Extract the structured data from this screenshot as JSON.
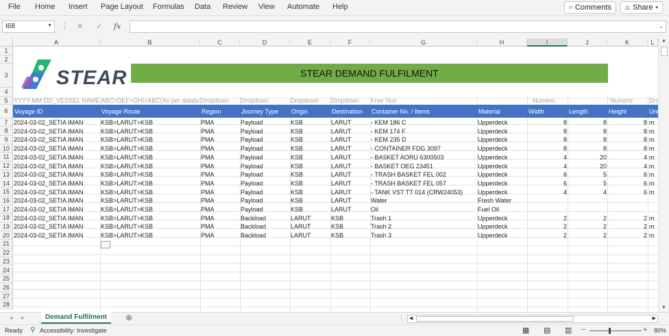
{
  "menu": [
    "File",
    "Home",
    "Insert",
    "Page Layout",
    "Formulas",
    "Data",
    "Review",
    "View",
    "Automate",
    "Help"
  ],
  "buttons": {
    "comments": "Comments",
    "share": "Share"
  },
  "namebox": "I68",
  "fx": "fx",
  "columns": [
    "A",
    "B",
    "C",
    "D",
    "E",
    "F",
    "G",
    "H",
    "I",
    "J",
    "K",
    "L"
  ],
  "selected_column": "I",
  "rows": [
    "1",
    "2",
    "3",
    "4",
    "5",
    "6",
    "7",
    "8",
    "9",
    "10",
    "11",
    "12",
    "13",
    "14",
    "15",
    "16",
    "17",
    "18",
    "19",
    "20",
    "21",
    "22",
    "23",
    "24",
    "25",
    "26",
    "27",
    "28"
  ],
  "banner": "STEAR DEMAND FULFILMENT",
  "logo": {
    "text": "STEAR",
    "colors": [
      "#3a7bd5",
      "#22b573",
      "#9b59b6"
    ]
  },
  "hints": {
    "a": "YYYY-MM-DD_VESSEL NAME",
    "b": "ABC>DEF>GHI>ABC(As per database)",
    "c": "Dropdown",
    "d": "Dropdown",
    "e": "Dropdown",
    "f": "Dropdown",
    "g": "Free Text",
    "i": "Numeric",
    "k": "Numeric",
    "l": "Dro"
  },
  "headers": {
    "a": "Voyage ID",
    "b": "Voyage Route",
    "c": "Region",
    "d": "Journey Type",
    "e": "Origin",
    "f": "Destination",
    "g": "Container No. / Items",
    "h": "Material",
    "i": "Width",
    "j": "Length",
    "k": "Height",
    "l": "Uni"
  },
  "table": [
    [
      "2024-03-02_SETIA IMAN",
      "KSB>LARUT>KSB",
      "PMA",
      "Payload",
      "KSB",
      "LARUT",
      "- KEM 186 C",
      "Upperdeck",
      "8",
      "8",
      "8",
      "m"
    ],
    [
      "2024-03-02_SETIA IMAN",
      "KSB>LARUT>KSB",
      "PMA",
      "Payload",
      "KSB",
      "LARUT",
      "- KEM 174 F",
      "Upperdeck",
      "8",
      "8",
      "8",
      "m"
    ],
    [
      "2024-03-02_SETIA IMAN",
      "KSB>LARUT>KSB",
      "PMA",
      "Payload",
      "KSB",
      "LARUT",
      "- KEM 235 D",
      "Upperdeck",
      "8",
      "8",
      "8",
      "m"
    ],
    [
      "2024-03-02_SETIA IMAN",
      "KSB>LARUT>KSB",
      "PMA",
      "Payload",
      "KSB",
      "LARUT",
      "- CONTAINER FDG 3097",
      "Upperdeck",
      "8",
      "8",
      "8",
      "m"
    ],
    [
      "2024-03-02_SETIA IMAN",
      "KSB>LARUT>KSB",
      "PMA",
      "Payload",
      "KSB",
      "LARUT",
      "- BASKET AORU 6300503",
      "Upperdeck",
      "4",
      "20",
      "4",
      "m"
    ],
    [
      "2024-03-02_SETIA IMAN",
      "KSB>LARUT>KSB",
      "PMA",
      "Payload",
      "KSB",
      "LARUT",
      "- BASKET OEG 23451",
      "Upperdeck",
      "4",
      "20",
      "4",
      "m"
    ],
    [
      "2024-03-02_SETIA IMAN",
      "KSB>LARUT>KSB",
      "PMA",
      "Payload",
      "KSB",
      "LARUT",
      "- TRASH  BASKET FEL 002",
      "Upperdeck",
      "6",
      "5",
      "6",
      "m"
    ],
    [
      "2024-03-02_SETIA IMAN",
      "KSB>LARUT>KSB",
      "PMA",
      "Payload",
      "KSB",
      "LARUT",
      "- TRASH  BASKET FEL 057",
      "Upperdeck",
      "6",
      "5",
      "6",
      "m"
    ],
    [
      "2024-03-02_SETIA IMAN",
      "KSB>LARUT>KSB",
      "PMA",
      "Payload",
      "KSB",
      "LARUT",
      "- TANK VST TT 014 (CRW24053)",
      "Upperdeck",
      "4",
      "4",
      "6",
      "m"
    ],
    [
      "2024-03-02_SETIA IMAN",
      "KSB>LARUT>KSB",
      "PMA",
      "Payload",
      "KSB",
      "LARUT",
      "Water",
      "Fresh Water",
      "",
      "",
      "",
      ""
    ],
    [
      "2024-03-02_SETIA IMAN",
      "KSB>LARUT>KSB",
      "PMA",
      "Payload",
      "KSB",
      "LARUT",
      "Oil",
      "Fuel Oil",
      "",
      "",
      "",
      ""
    ],
    [
      "2024-03-02_SETIA IMAN",
      "KSB>LARUT>KSB",
      "PMA",
      "Backload",
      "LARUT",
      "KSB",
      "Trash 1",
      "Upperdeck",
      "2",
      "2",
      "2",
      "m"
    ],
    [
      "2024-03-02_SETIA IMAN",
      "KSB>LARUT>KSB",
      "PMA",
      "Backload",
      "LARUT",
      "KSB",
      "Trash 2",
      "Upperdeck",
      "2",
      "2",
      "2",
      "m"
    ],
    [
      "2024-03-02_SETIA IMAN",
      "KSB>LARUT>KSB",
      "PMA",
      "Backload",
      "LARUT",
      "KSB",
      "Trash 3",
      "Upperdeck",
      "2",
      "2",
      "2",
      "m"
    ]
  ],
  "sheet_tab": "Demand Fulfilment",
  "status": {
    "ready": "Ready",
    "accessibility": "Accessibility: Investigate",
    "zoom": "80%"
  },
  "colors": {
    "accent": "#217346",
    "header_blue": "#4472c4",
    "banner_green": "#70ad47"
  }
}
